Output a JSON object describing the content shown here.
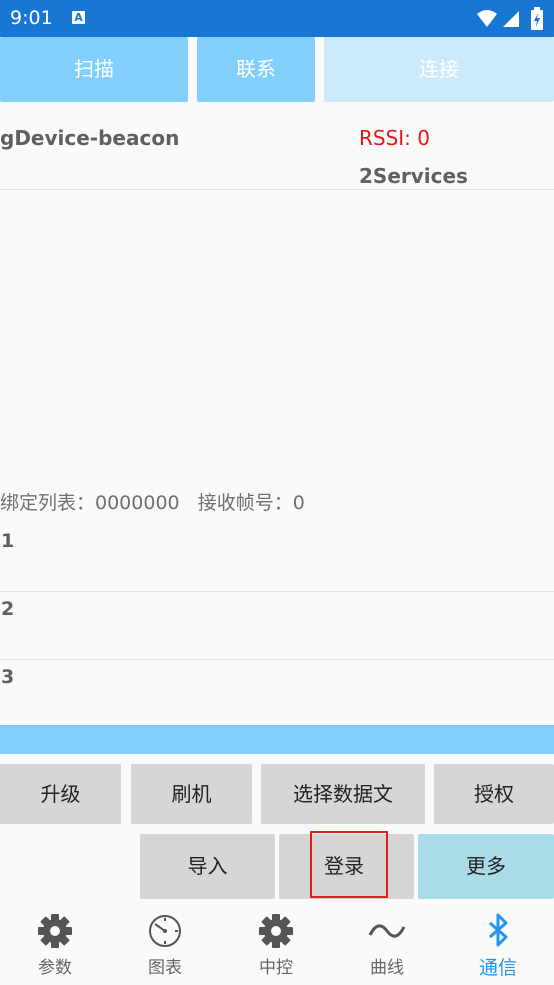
{
  "status_bar": {
    "time": "9:01",
    "notification_icon": "A"
  },
  "top_buttons": {
    "scan": "扫描",
    "contact": "联系",
    "connect": "连接"
  },
  "device": {
    "name": "gDevice-beacon",
    "rssi": "RSSI: 0",
    "services": "2Services"
  },
  "bind_info": "绑定列表：0000000   接收帧号：0",
  "rows": [
    "1",
    "2",
    "3"
  ],
  "buttons": {
    "upgrade": "升级",
    "flash": "刷机",
    "select_file": "选择数据文",
    "authorize": "授权",
    "import": "导入",
    "login": "登录",
    "more": "更多"
  },
  "nav": {
    "params": "参数",
    "charts": "图表",
    "control": "中控",
    "curve": "曲线",
    "comm": "通信"
  },
  "colors": {
    "accent": "#2196f3",
    "status_bar": "#1976d2",
    "button_blue": "#81cffa",
    "rssi_red": "#e8141a"
  }
}
